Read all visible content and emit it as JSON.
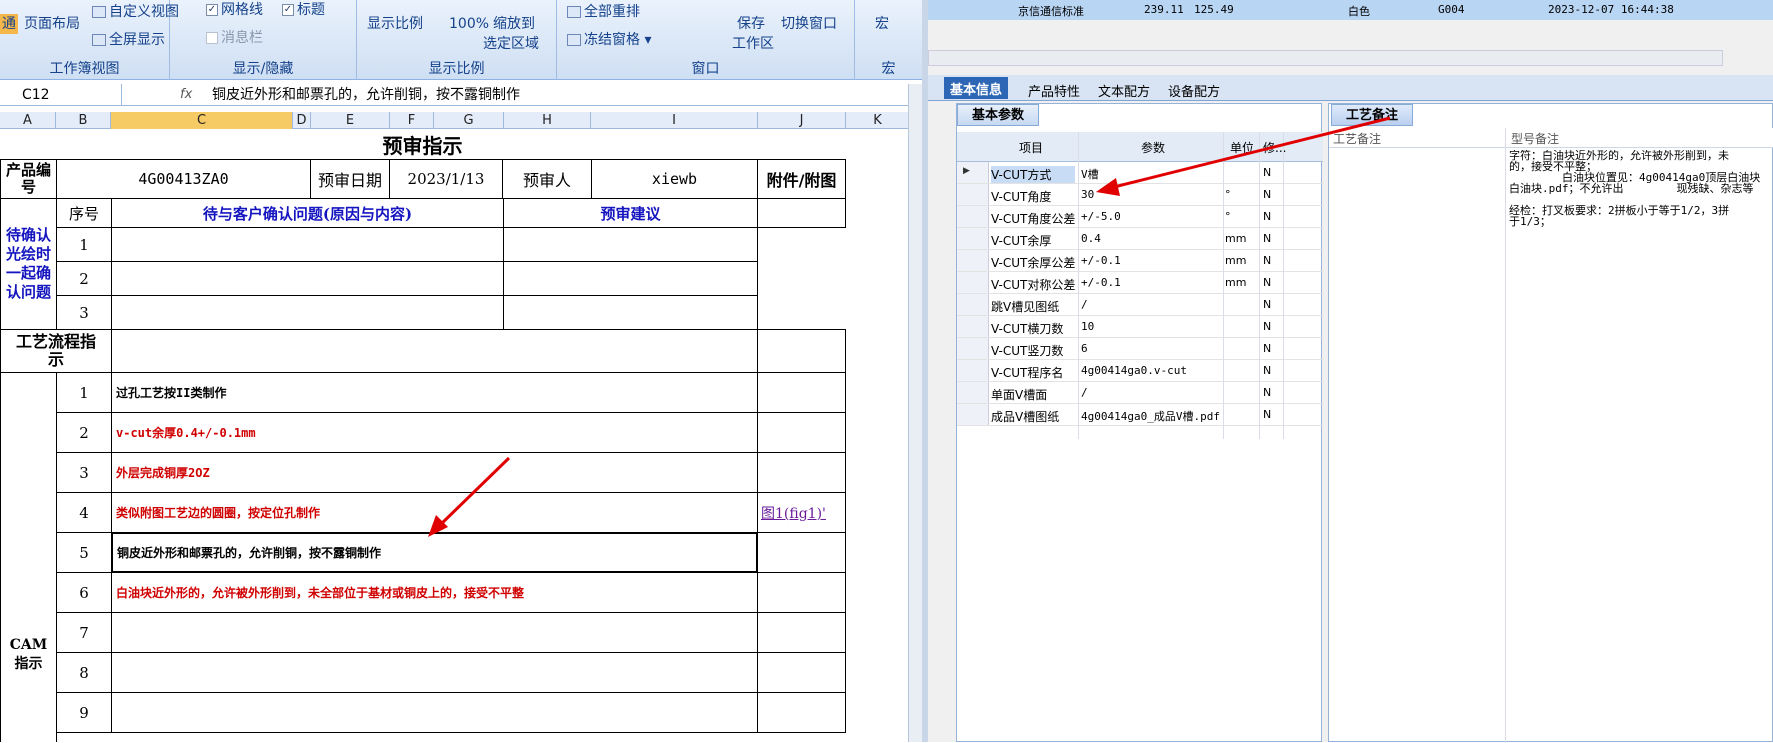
{
  "excel": {
    "ribbon": {
      "groups": [
        {
          "label": "工作簿视图",
          "items": [
            "通",
            "页面布局",
            "自定义视图",
            "全屏显示"
          ]
        },
        {
          "label": "显示/隐藏",
          "items": [
            "网格线",
            "标题",
            "消息栏"
          ]
        },
        {
          "label": "显示比例",
          "items": [
            "显示比例",
            "100%",
            "缩放到",
            "选定区域"
          ]
        },
        {
          "label": "窗口",
          "items": [
            "全部重排",
            "冻结窗格",
            "保存",
            "工作区",
            "切换窗口"
          ]
        },
        {
          "label": "宏",
          "items": [
            "宏"
          ]
        }
      ]
    },
    "namebox": "C12",
    "fx": "fx",
    "formula": "铜皮近外形和邮票孔的，允许削铜，按不露铜制作",
    "columns": [
      "A",
      "B",
      "C",
      "D",
      "E",
      "F",
      "G",
      "H",
      "I",
      "J",
      "K"
    ],
    "title": "预审指示",
    "header": {
      "product_no_label": "产品编号",
      "product_no": "4G00413ZA0",
      "date_label": "预审日期",
      "date": "2023/1/13",
      "reviewer_label": "预审人",
      "reviewer": "xiewb",
      "attach_label": "附件/附图"
    },
    "confirm": {
      "side_label": "待确认光绘时一起确认问题",
      "seq_label": "序号",
      "issue_label": "待与客户确认问题(原因与内容)",
      "advice_label": "预审建议",
      "rows": [
        "1",
        "2",
        "3"
      ]
    },
    "process_label": "工艺流程指示",
    "cam_label": "CAM指示",
    "cam_rows": [
      {
        "n": "1",
        "text": "过孔工艺按II类制作",
        "color": "#000000"
      },
      {
        "n": "2",
        "text": "v-cut余厚0.4+/-0.1mm",
        "color": "#d00000"
      },
      {
        "n": "3",
        "text": "外层完成铜厚2OZ",
        "color": "#d00000"
      },
      {
        "n": "4",
        "text": "类似附图工艺边的圆圈，按定位孔制作",
        "color": "#d00000",
        "attach": "图1(fig1)'"
      },
      {
        "n": "5",
        "text": "铜皮近外形和邮票孔的，允许削铜，按不露铜制作",
        "color": "#000000"
      },
      {
        "n": "6",
        "text": "白油块近外形的，允许被外形削到，未全部位于基材或铜皮上的，接受不平整",
        "color": "#d00000"
      },
      {
        "n": "7",
        "text": "",
        "color": "#000000"
      },
      {
        "n": "8",
        "text": "",
        "color": "#000000"
      },
      {
        "n": "9",
        "text": "",
        "color": "#000000"
      }
    ]
  },
  "right": {
    "top_row": [
      "京信通信标准",
      "239.11",
      "125.49",
      "白色",
      "G004",
      "2023-12-07 16:44:38"
    ],
    "tabs": [
      "基本信息",
      "产品特性",
      "文本配方",
      "设备配方"
    ],
    "left_pane": {
      "tab": "基本参数",
      "columns": [
        "项目",
        "参数",
        "单位",
        "修..."
      ],
      "rows": [
        {
          "item": "V-CUT方式",
          "value": "V槽",
          "unit": "",
          "flag": "N"
        },
        {
          "item": "V-CUT角度",
          "value": "30",
          "unit": "°",
          "flag": "N"
        },
        {
          "item": "V-CUT角度公差",
          "value": "+/-5.0",
          "unit": "°",
          "flag": "N"
        },
        {
          "item": "V-CUT余厚",
          "value": "0.4",
          "unit": "mm",
          "flag": "N"
        },
        {
          "item": "V-CUT余厚公差",
          "value": "+/-0.1",
          "unit": "mm",
          "flag": "N"
        },
        {
          "item": "V-CUT对称公差",
          "value": "+/-0.1",
          "unit": "mm",
          "flag": "N"
        },
        {
          "item": "跳V槽见图纸",
          "value": "/",
          "unit": "",
          "flag": "N"
        },
        {
          "item": "V-CUT横刀数",
          "value": "10",
          "unit": "",
          "flag": "N"
        },
        {
          "item": "V-CUT竖刀数",
          "value": "6",
          "unit": "",
          "flag": "N"
        },
        {
          "item": "V-CUT程序名",
          "value": "4g00414ga0.v-cut",
          "unit": "",
          "flag": "N"
        },
        {
          "item": "单面V槽面",
          "value": "/",
          "unit": "",
          "flag": "N"
        },
        {
          "item": "成品V槽图纸",
          "value": "4g00414ga0_成品V槽.pdf",
          "unit": "",
          "flag": "N"
        }
      ]
    },
    "right_pane": {
      "tab": "工艺备注",
      "col1": "工艺备注",
      "col2": "型号备注",
      "note_lines": [
        "字符：白油块近外形的，允许被外形削到，未",
        "的，接受不平整；",
        "        白油块位置见：4g00414ga0顶层白油块",
        "白油块.pdf；不允许出        现残缺、杂志等",
        "",
        "经检：打叉板要求：2拼板小于等于1/2，3拼",
        "于1/3；"
      ]
    }
  }
}
